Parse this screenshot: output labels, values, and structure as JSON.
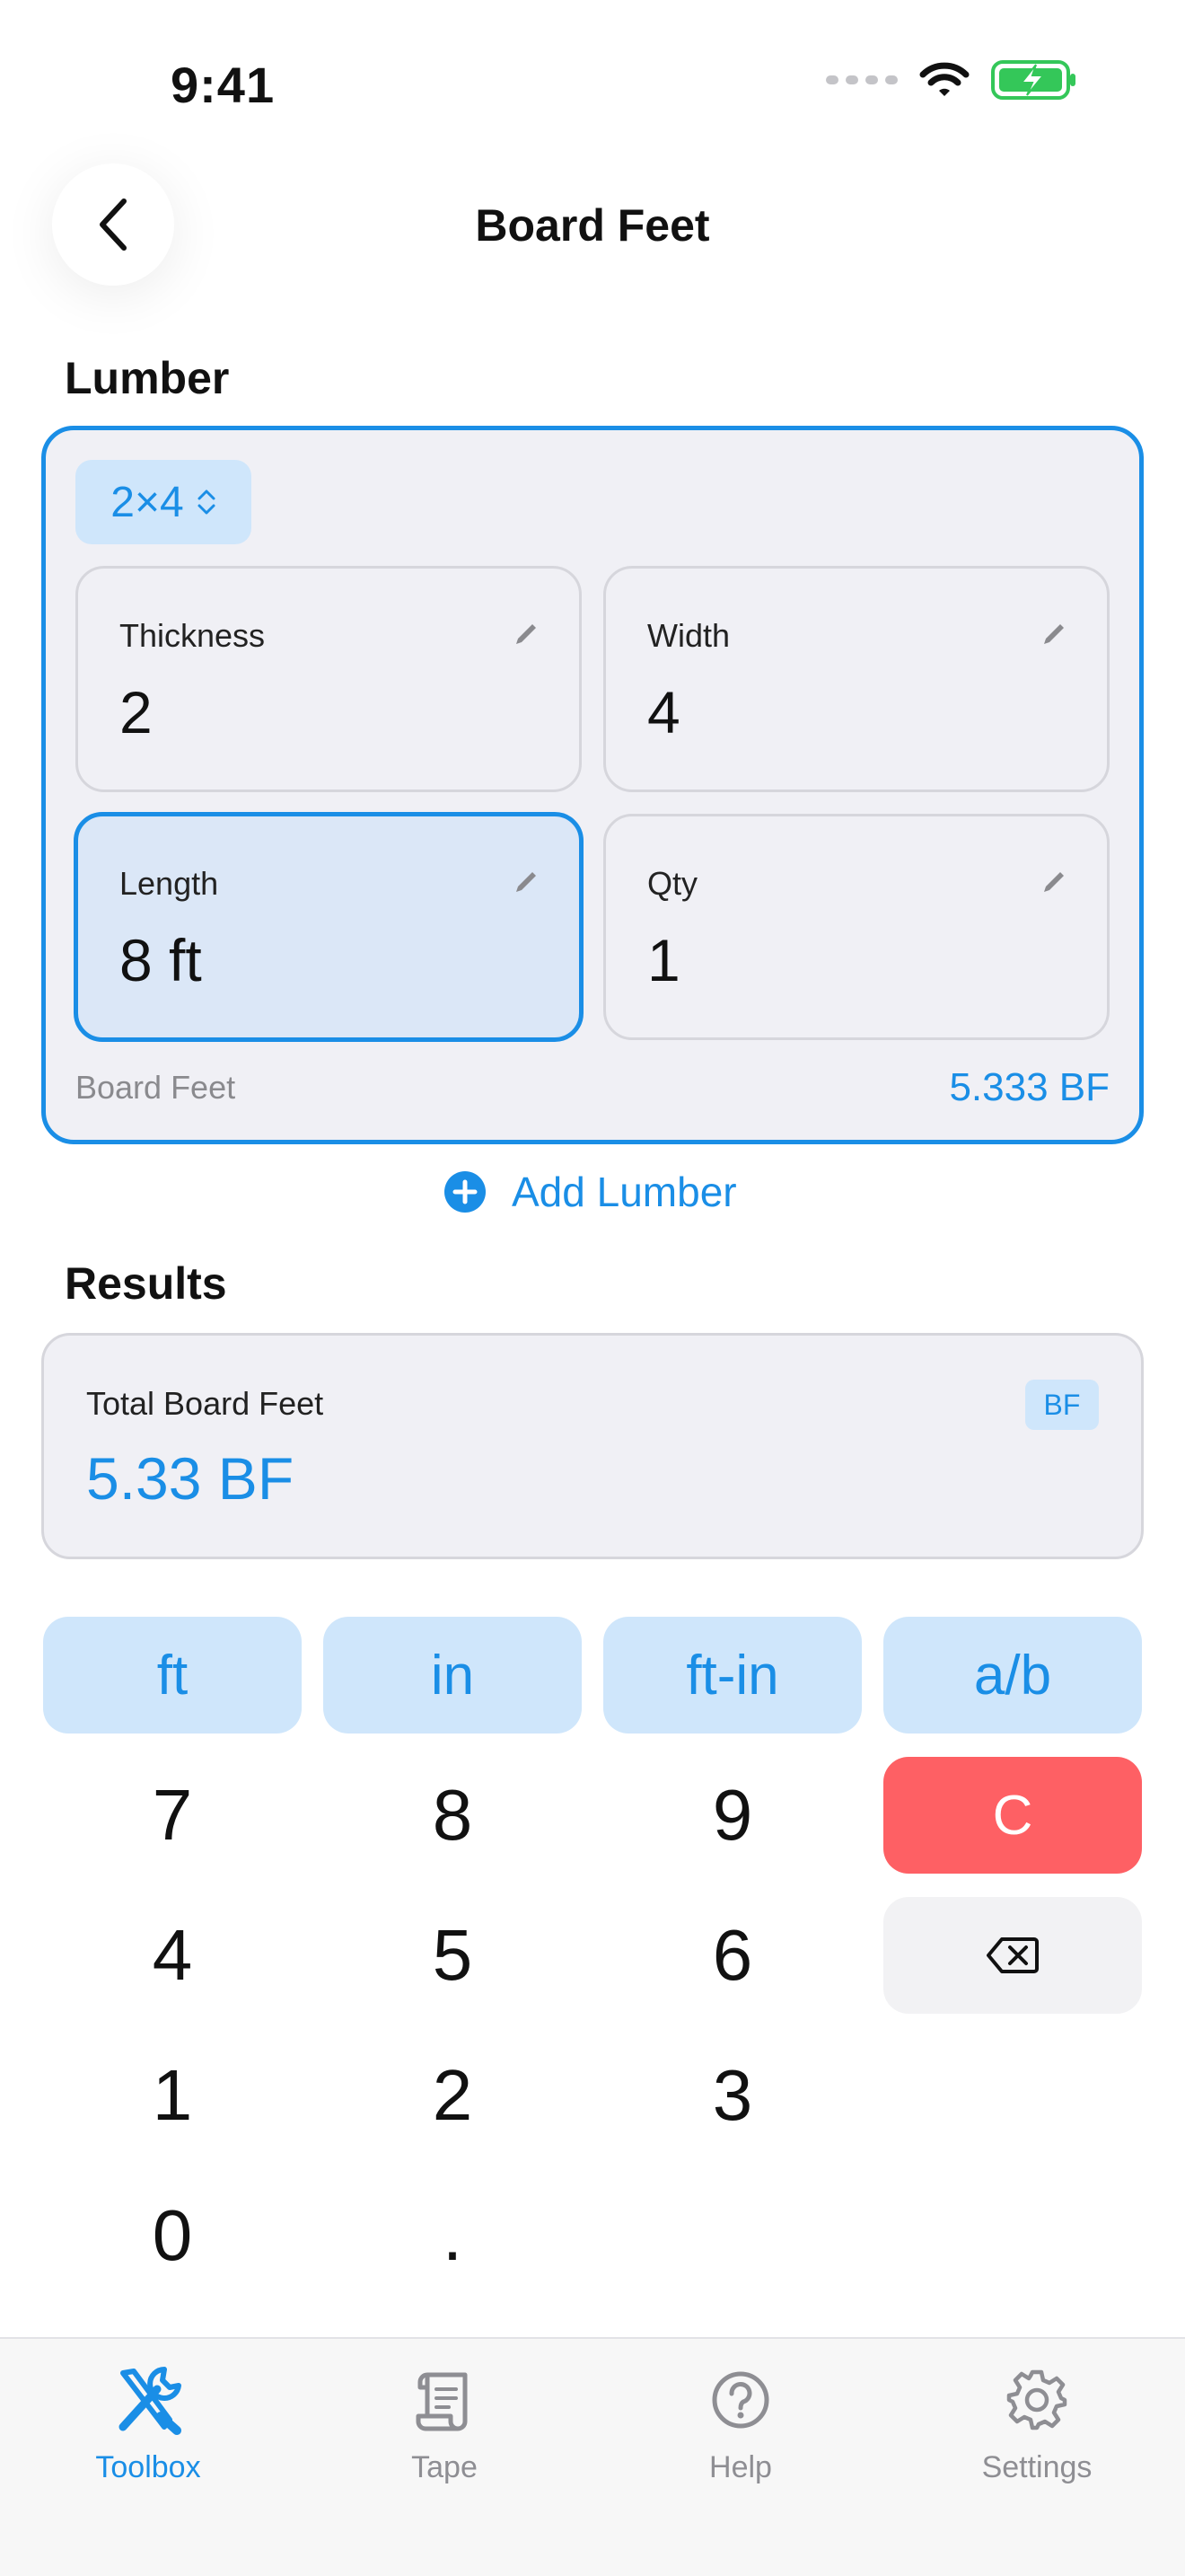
{
  "status_bar": {
    "time": "9:41"
  },
  "header": {
    "title": "Board Feet"
  },
  "lumber": {
    "section_title": "Lumber",
    "preset": "2×4",
    "fields": [
      {
        "label": "Thickness",
        "value": "2"
      },
      {
        "label": "Width",
        "value": "4"
      },
      {
        "label": "Length",
        "value": "8 ft"
      },
      {
        "label": "Qty",
        "value": "1"
      }
    ],
    "active_field": "Length",
    "board_feet_label": "Board Feet",
    "board_feet_value": "5.333 BF",
    "add_label": "Add Lumber"
  },
  "results": {
    "section_title": "Results",
    "label": "Total Board Feet",
    "value": "5.33 BF",
    "badge": "BF"
  },
  "keypad": {
    "units": [
      "ft",
      "in",
      "ft-in",
      "a/b"
    ],
    "rows": [
      [
        "7",
        "8",
        "9"
      ],
      [
        "4",
        "5",
        "6"
      ],
      [
        "1",
        "2",
        "3"
      ],
      [
        "0",
        "."
      ]
    ],
    "clear_label": "C"
  },
  "tabs": [
    {
      "label": "Toolbox",
      "icon": "tools-icon",
      "active": true
    },
    {
      "label": "Tape",
      "icon": "scroll-icon",
      "active": false
    },
    {
      "label": "Help",
      "icon": "question-circle-icon",
      "active": false
    },
    {
      "label": "Settings",
      "icon": "gear-icon",
      "active": false
    }
  ],
  "colors": {
    "accent": "#1a8ee6",
    "accent_light": "#cfe6fb",
    "clear": "#fe6064",
    "battery": "#34c759"
  }
}
